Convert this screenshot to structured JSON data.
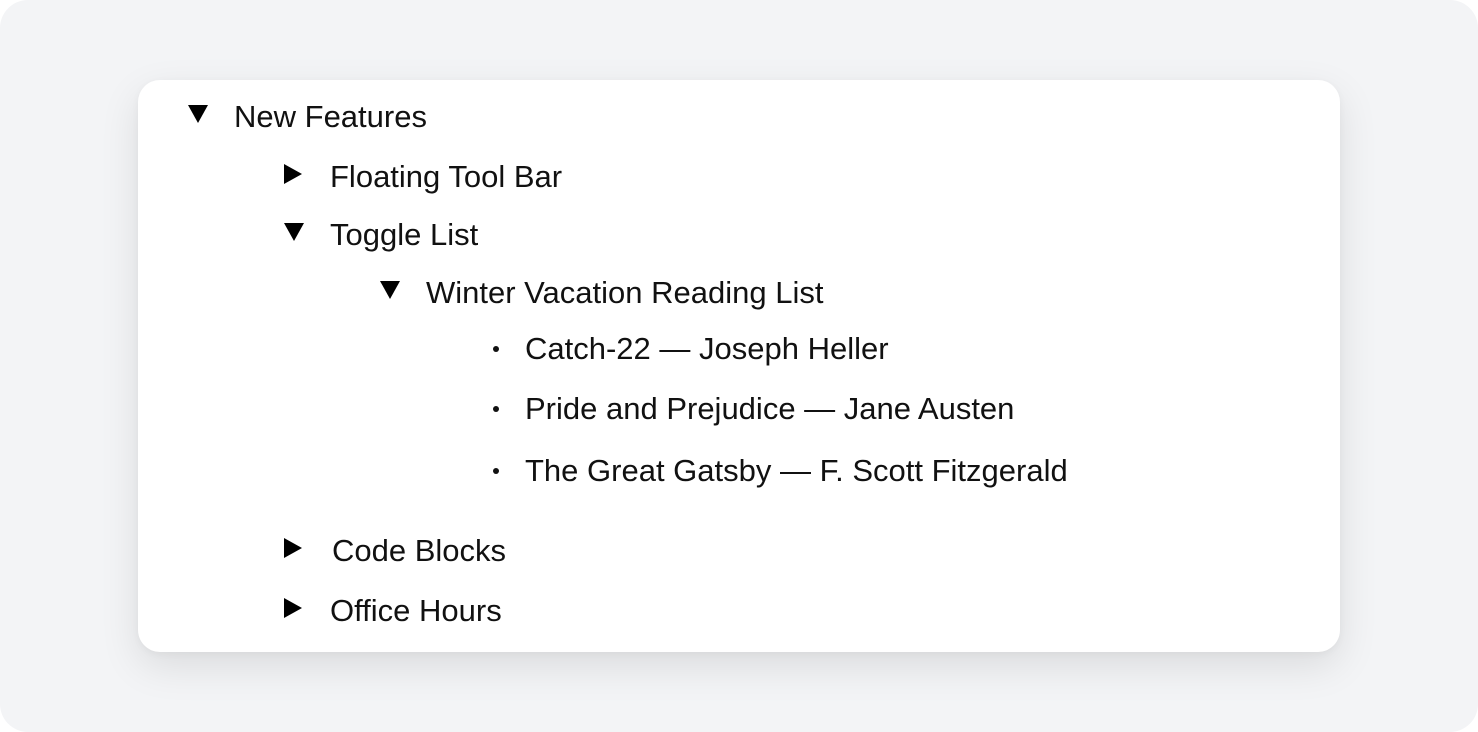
{
  "tree": {
    "root": {
      "label": "New Features",
      "expanded": true,
      "icon": "triangle-down-icon"
    },
    "children": [
      {
        "label": "Floating Tool Bar",
        "expanded": false,
        "icon": "triangle-right-icon"
      },
      {
        "label": "Toggle List",
        "expanded": true,
        "icon": "triangle-down-icon"
      },
      {
        "label": "Winter Vacation Reading List",
        "expanded": true,
        "icon": "triangle-down-icon"
      },
      {
        "label": "Code Blocks",
        "expanded": false,
        "icon": "triangle-right-icon"
      },
      {
        "label": "Office Hours",
        "expanded": false,
        "icon": "triangle-right-icon"
      }
    ],
    "reading_list": [
      {
        "label": "Catch-22 — Joseph Heller"
      },
      {
        "label": "Pride and Prejudice — Jane Austen"
      },
      {
        "label": "The Great Gatsby — F. Scott Fitzgerald"
      }
    ]
  },
  "colors": {
    "background": "#f3f4f6",
    "card": "#ffffff",
    "text": "#111111"
  }
}
